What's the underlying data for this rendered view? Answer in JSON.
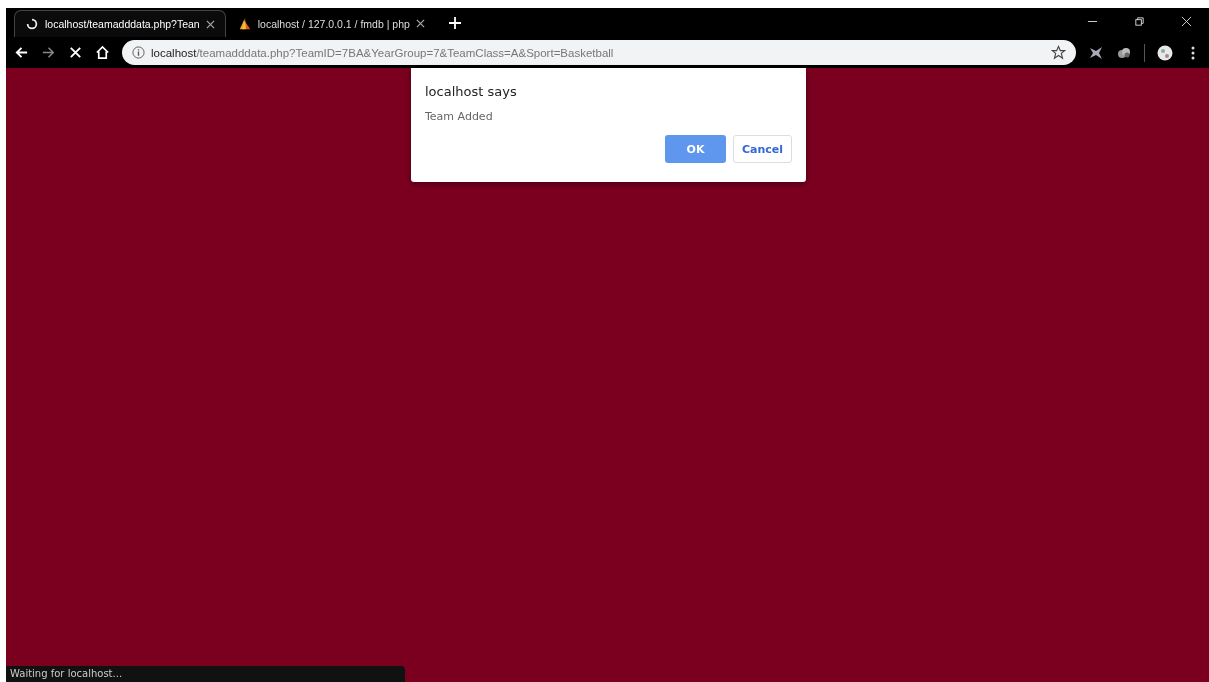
{
  "tabs": [
    {
      "title": "localhost/teamadddata.php?Tean",
      "selected": true
    },
    {
      "title": "localhost / 127.0.0.1 / fmdb | php",
      "selected": false
    }
  ],
  "address": {
    "host": "localhost",
    "path": "/teamadddata.php?TeamID=7BA&YearGroup=7&TeamClass=A&Sport=Basketball"
  },
  "dialog": {
    "title": "localhost says",
    "message": "Team Added",
    "buttons": [
      {
        "label": "OK",
        "kind": "primary"
      },
      {
        "label": "Cancel",
        "kind": "secondary"
      }
    ]
  },
  "status_bar": "Waiting for localhost..."
}
